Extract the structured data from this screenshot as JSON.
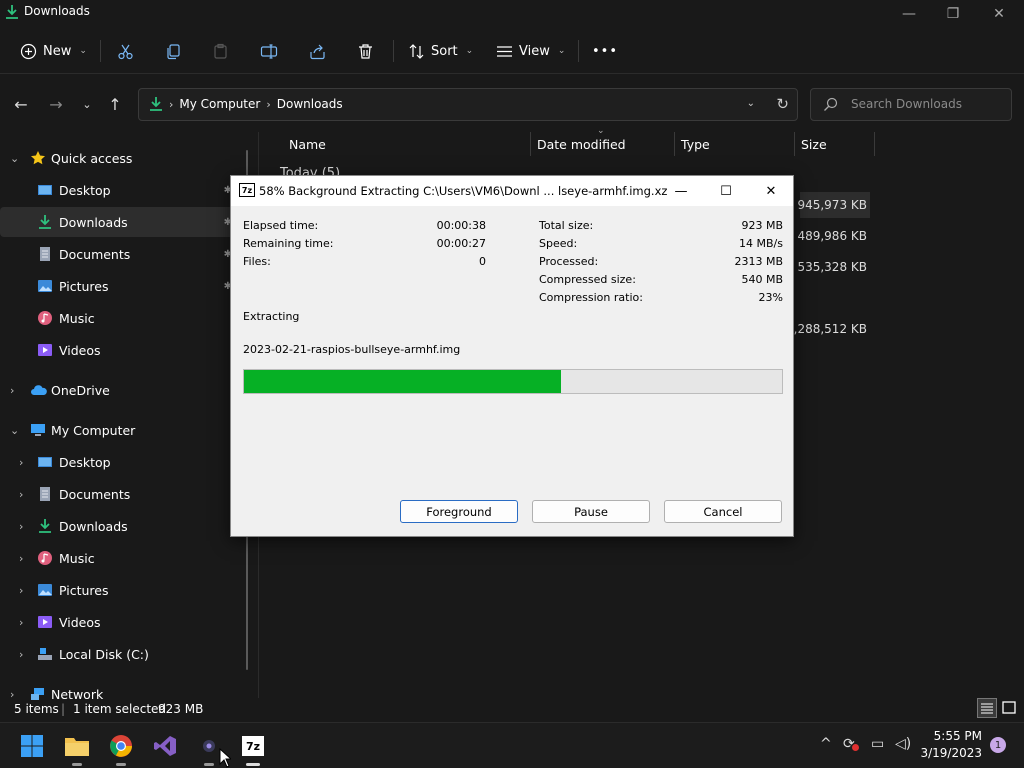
{
  "explorer": {
    "title": "Downloads",
    "toolbar": {
      "new": "New",
      "sort": "Sort",
      "view": "View",
      "more": "•••"
    },
    "breadcrumb": [
      "My Computer",
      "Downloads"
    ],
    "search_placeholder": "Search Downloads",
    "sidebar": [
      {
        "label": "Quick access",
        "icon": "star-icon",
        "expand": "v"
      },
      {
        "label": "Desktop",
        "icon": "desktop-icon",
        "pin": true
      },
      {
        "label": "Downloads",
        "icon": "download-icon",
        "pin": true,
        "selected": true
      },
      {
        "label": "Documents",
        "icon": "document-icon",
        "pin": true
      },
      {
        "label": "Pictures",
        "icon": "pictures-icon",
        "pin": true
      },
      {
        "label": "Music",
        "icon": "music-icon"
      },
      {
        "label": "Videos",
        "icon": "videos-icon"
      },
      {
        "label": "OneDrive",
        "icon": "cloud-icon",
        "expand": ">"
      },
      {
        "label": "My Computer",
        "icon": "computer-icon",
        "expand": "v"
      },
      {
        "label": "Desktop",
        "icon": "desktop-icon",
        "expand": ">"
      },
      {
        "label": "Documents",
        "icon": "document-icon",
        "expand": ">"
      },
      {
        "label": "Downloads",
        "icon": "download-icon",
        "expand": ">"
      },
      {
        "label": "Music",
        "icon": "music-icon",
        "expand": ">"
      },
      {
        "label": "Pictures",
        "icon": "pictures-icon",
        "expand": ">"
      },
      {
        "label": "Videos",
        "icon": "videos-icon",
        "expand": ">"
      },
      {
        "label": "Local Disk (C:)",
        "icon": "drive-icon",
        "expand": ">"
      },
      {
        "label": "Network",
        "icon": "network-icon",
        "expand": ">"
      }
    ],
    "columns": {
      "name": "Name",
      "date": "Date modified",
      "type": "Type",
      "size": "Size"
    },
    "group": "Today (5)",
    "sizes": [
      "945,973 KB",
      "489,986 KB",
      "535,328 KB",
      "4,288,512 KB"
    ],
    "status": {
      "items": "5 items",
      "selected": "1 item selected",
      "selsize": "923 MB"
    }
  },
  "dialog": {
    "title": "58% Background Extracting C:\\Users\\VM6\\Downl ... lseye-armhf.img.xz",
    "left": [
      {
        "label": "Elapsed time:",
        "value": "00:00:38"
      },
      {
        "label": "Remaining time:",
        "value": "00:00:27"
      },
      {
        "label": "Files:",
        "value": "0"
      }
    ],
    "right": [
      {
        "label": "Total size:",
        "value": "923 MB"
      },
      {
        "label": "Speed:",
        "value": "14 MB/s"
      },
      {
        "label": "Processed:",
        "value": "2313 MB"
      },
      {
        "label": "Compressed size:",
        "value": "540 MB"
      },
      {
        "label": "Compression ratio:",
        "value": "23%"
      }
    ],
    "status": "Extracting",
    "filename": "2023-02-21-raspios-bullseye-armhf.img",
    "progress": 0.59,
    "buttons": {
      "foreground": "Foreground",
      "pause": "Pause",
      "cancel": "Cancel"
    },
    "accent": "#06b025"
  },
  "taskbar": {
    "time": "5:55 PM",
    "date": "3/19/2023",
    "notifications": "1",
    "seven_zip_label": "7z"
  }
}
